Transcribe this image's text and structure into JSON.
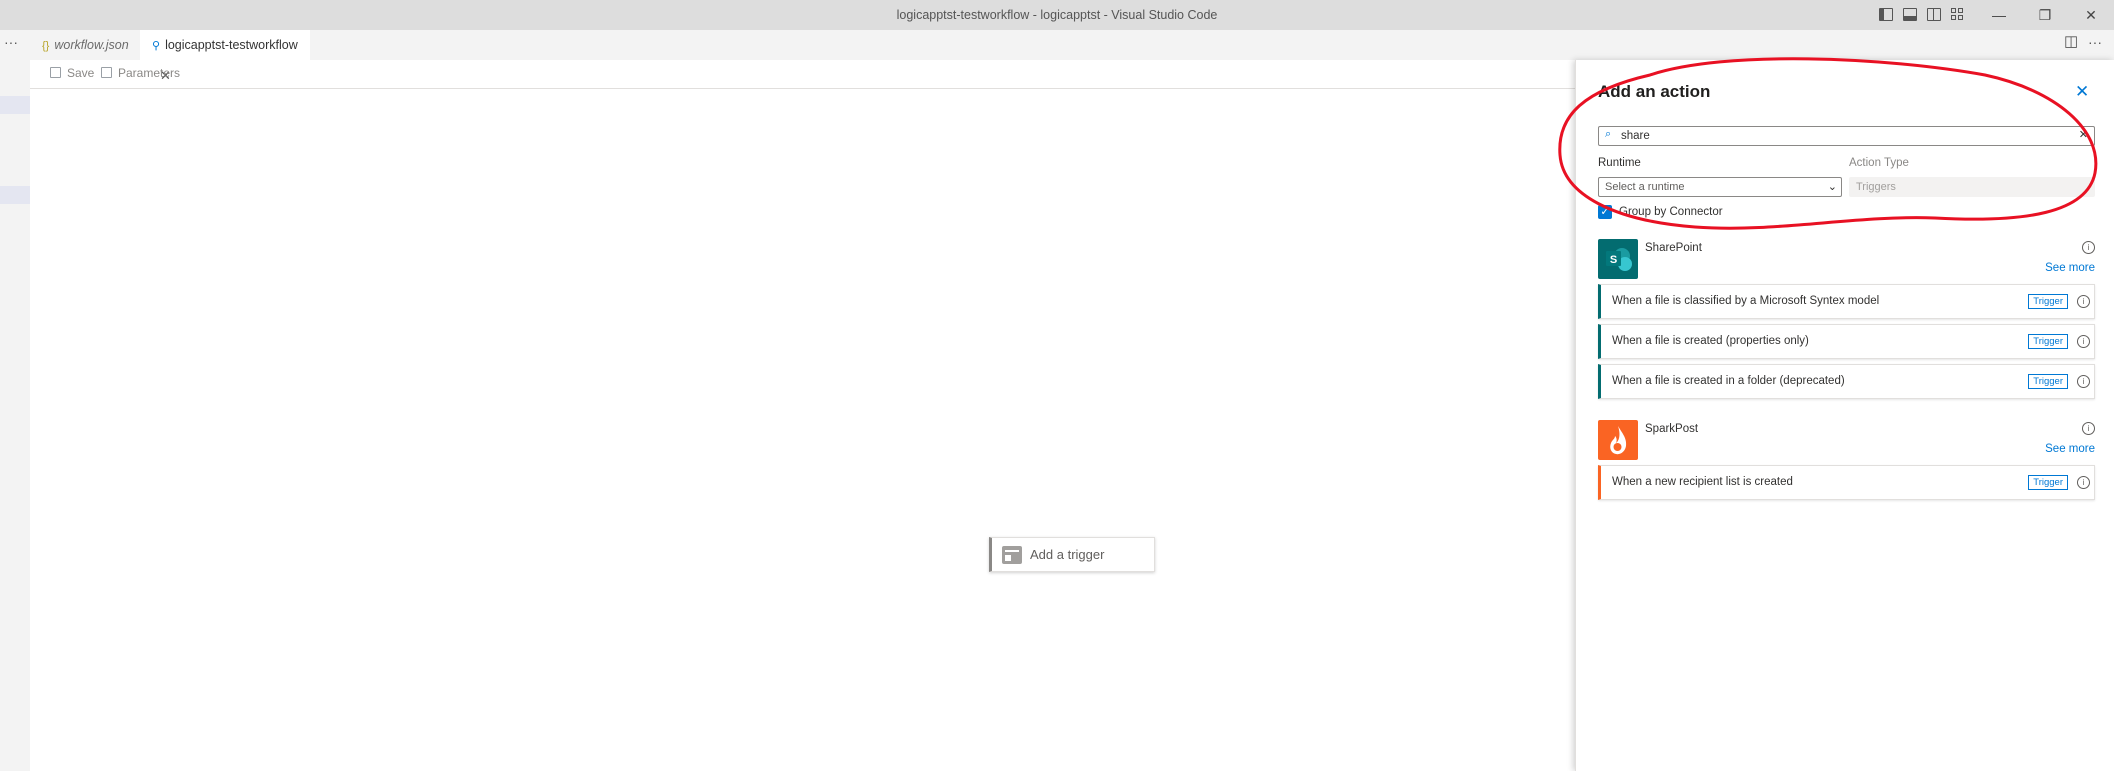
{
  "window": {
    "title": "logicapptst-testworkflow - logicapptst - Visual Studio Code",
    "controls": {
      "minimize": "—",
      "restore": "❐",
      "close": "✕"
    }
  },
  "tabs": [
    {
      "label": "workflow.json",
      "icon": "{}",
      "active": false
    },
    {
      "label": "logicapptst-testworkflow",
      "icon": "⚲",
      "active": true,
      "close": "✕"
    }
  ],
  "tabbar": {
    "left_more": "···",
    "right_more": "···",
    "split": "◫"
  },
  "toolbar": {
    "save_label": "Save",
    "parameters_label": "Parameters"
  },
  "canvas": {
    "trigger_label": "Add a trigger"
  },
  "panel": {
    "title": "Add an action",
    "close": "✕",
    "search": {
      "value": "share",
      "icon": "⌕",
      "clear": "✕"
    },
    "runtime_label": "Runtime",
    "runtime_placeholder": "Select a runtime",
    "action_type_label": "Action Type",
    "action_type_value": "Triggers",
    "group_by_label": "Group by Connector",
    "group_by_checked": true,
    "connectors": [
      {
        "name": "SharePoint",
        "see_more": "See more",
        "color": "#036c70",
        "logo_text": "S",
        "operations": [
          {
            "name": "When a file is classified by a Microsoft Syntex model",
            "badge": "Trigger"
          },
          {
            "name": "When a file is created (properties only)",
            "badge": "Trigger"
          },
          {
            "name": "When a file is created in a folder (deprecated)",
            "badge": "Trigger"
          }
        ]
      },
      {
        "name": "SparkPost",
        "see_more": "See more",
        "color": "#fa6423",
        "operations": [
          {
            "name": "When a new recipient list is created",
            "badge": "Trigger"
          }
        ]
      }
    ]
  },
  "colors": {
    "accent": "#0078d4",
    "annotation": "#e81123"
  }
}
